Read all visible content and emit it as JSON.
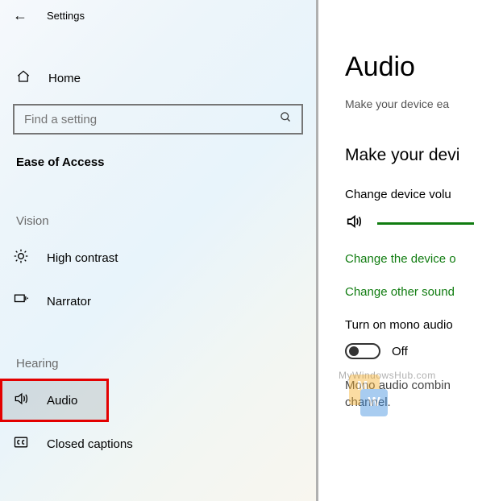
{
  "app_title": "Settings",
  "sidebar": {
    "home_label": "Home",
    "search_placeholder": "Find a setting",
    "section_title": "Ease of Access",
    "groups": {
      "vision": {
        "label": "Vision",
        "items": [
          {
            "label": "High contrast"
          },
          {
            "label": "Narrator"
          }
        ]
      },
      "hearing": {
        "label": "Hearing",
        "items": [
          {
            "label": "Audio"
          },
          {
            "label": "Closed captions"
          }
        ]
      }
    }
  },
  "content": {
    "title": "Audio",
    "subtitle": "Make your device ea",
    "heading": "Make your devi",
    "volume_label": "Change device volu",
    "link1": "Change the device o",
    "link2": "Change other sound",
    "mono_label": "Turn on mono audio",
    "toggle_state": "Off",
    "mono_desc_line1": "Mono audio combin",
    "mono_desc_line2": "channel."
  }
}
